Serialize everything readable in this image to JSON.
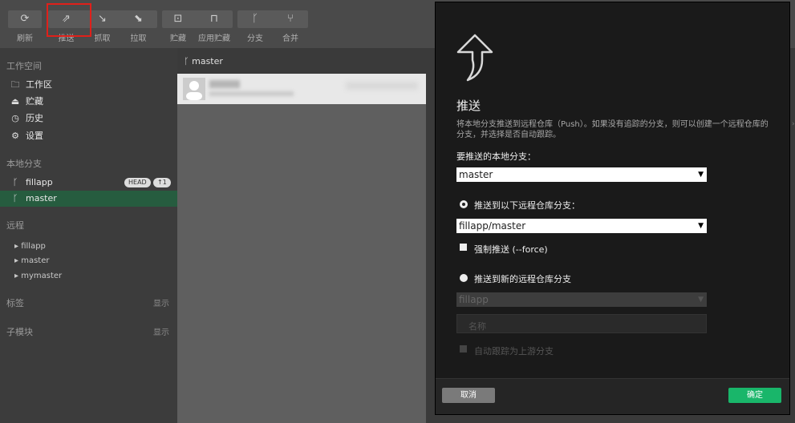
{
  "toolbar": {
    "buttons": [
      {
        "label": "刷新",
        "icon": "refresh-icon"
      },
      {
        "label": "推送",
        "icon": "push-icon"
      },
      {
        "label": "抓取",
        "icon": "fetch-icon"
      },
      {
        "label": "拉取",
        "icon": "pull-icon"
      },
      {
        "label": "贮藏",
        "icon": "stash-icon"
      },
      {
        "label": "应用贮藏",
        "icon": "apply-stash-icon"
      },
      {
        "label": "分支",
        "icon": "branch-icon"
      },
      {
        "label": "合并",
        "icon": "merge-icon"
      }
    ]
  },
  "sidebar": {
    "workspace_title": "工作空间",
    "workspace_items": [
      {
        "label": "工作区",
        "icon": "folder-icon"
      },
      {
        "label": "贮藏",
        "icon": "stash-icon"
      },
      {
        "label": "历史",
        "icon": "history-icon"
      },
      {
        "label": "设置",
        "icon": "gear-icon"
      }
    ],
    "local_branches_title": "本地分支",
    "local_branches": [
      {
        "label": "fillapp",
        "head_badge": "HEAD",
        "ahead_badge": "↑1"
      },
      {
        "label": "master"
      }
    ],
    "remote_title": "远程",
    "remotes": [
      "fillapp",
      "master",
      "mymaster"
    ],
    "tags_title": "标签",
    "tags_action": "显示",
    "submodules_title": "子模块",
    "submodules_action": "显示"
  },
  "middle": {
    "branch_header": "master"
  },
  "dialog": {
    "title": "推送",
    "description": "将本地分支推送到远程仓库（Push）。如果没有追踪的分支，则可以创建一个远程仓库的分支，并选择是否自动跟踪。",
    "local_branch_label": "要推送的本地分支：",
    "local_branch_value": "master",
    "radio_existing_label": "推送到以下远程仓库分支：",
    "remote_branch_value": "fillapp/master",
    "force_label": "强制推送 (--force)",
    "radio_new_label": "推送到新的远程仓库分支",
    "new_remote_value": "fillapp",
    "name_placeholder": "名称",
    "track_label": "自动跟踪为上游分支",
    "cancel_label": "取消",
    "ok_label": "确定"
  },
  "colors": {
    "accent_green": "#19b66a",
    "active_branch_bg": "#265c3f",
    "highlight_red": "#e0201a"
  }
}
